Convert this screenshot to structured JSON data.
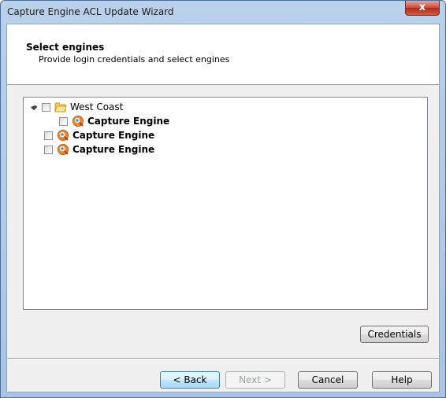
{
  "window": {
    "title": "Capture Engine ACL Update Wizard",
    "close_label": "x"
  },
  "header": {
    "title": "Select engines",
    "subtitle": "Provide login credentials and select engines"
  },
  "tree": {
    "items": [
      {
        "label": "West Coast",
        "icon": "folder-icon",
        "bold": false,
        "checked": false,
        "expanded": true
      },
      {
        "label": "Capture Engine",
        "icon": "capture-engine-icon",
        "bold": true,
        "checked": false
      },
      {
        "label": "Capture Engine",
        "icon": "capture-engine-icon",
        "bold": true,
        "checked": false
      },
      {
        "label": "Capture Engine",
        "icon": "capture-engine-icon",
        "bold": true,
        "checked": false
      }
    ]
  },
  "buttons": {
    "credentials": "Credentials",
    "back": "< Back",
    "next": "Next >",
    "cancel": "Cancel",
    "help": "Help"
  },
  "colors": {
    "titlebar": "#b9d1ea",
    "dialog_bg": "#f0f0f0",
    "close_button": "#c9463a",
    "default_button": "#3c7fb1"
  }
}
